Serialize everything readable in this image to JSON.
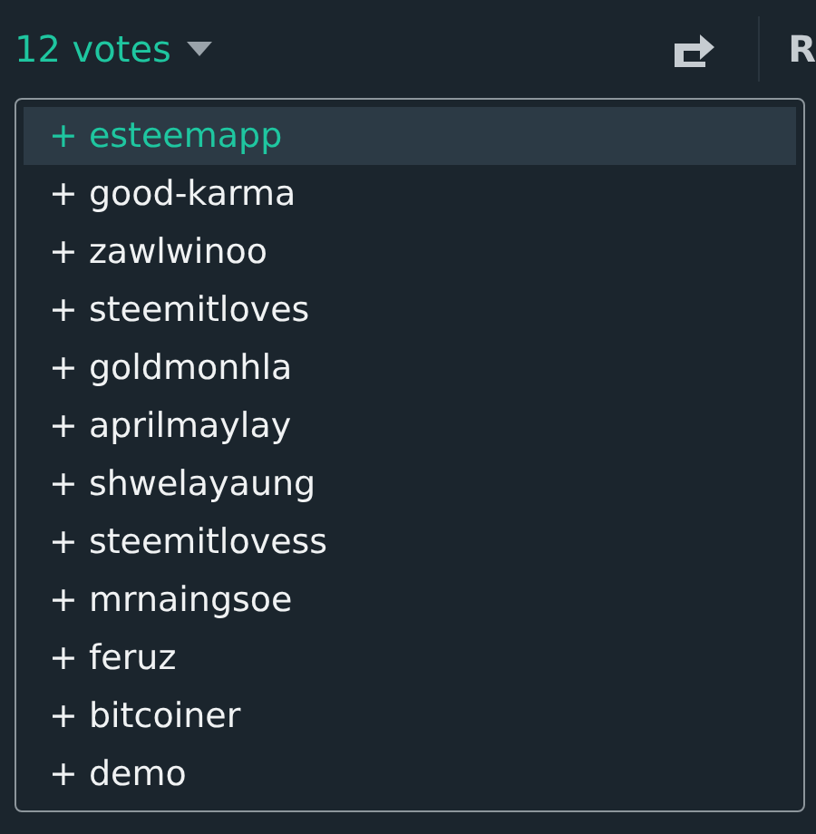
{
  "votes_button": {
    "label": "12 votes"
  },
  "side_label": "R",
  "voters": [
    {
      "label": "+ esteemapp",
      "selected": true
    },
    {
      "label": "+ good-karma",
      "selected": false
    },
    {
      "label": "+ zawlwinoo",
      "selected": false
    },
    {
      "label": "+ steemitloves",
      "selected": false
    },
    {
      "label": "+ goldmonhla",
      "selected": false
    },
    {
      "label": "+ aprilmaylay",
      "selected": false
    },
    {
      "label": "+ shwelayaung",
      "selected": false
    },
    {
      "label": "+ steemitlovess",
      "selected": false
    },
    {
      "label": "+ mrnaingsoe",
      "selected": false
    },
    {
      "label": "+ feruz",
      "selected": false
    },
    {
      "label": "+ bitcoiner",
      "selected": false
    },
    {
      "label": "+ demo",
      "selected": false
    }
  ]
}
